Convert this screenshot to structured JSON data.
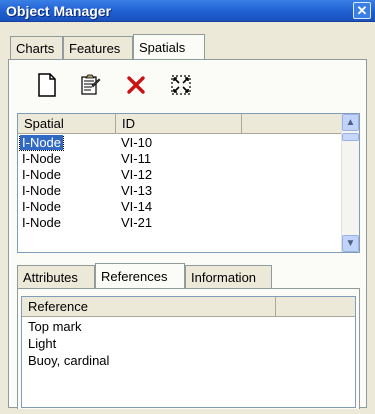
{
  "window": {
    "title": "Object Manager",
    "close_glyph": "✕"
  },
  "tabs": [
    "Charts",
    "Features",
    "Spatials"
  ],
  "active_tab": "Spatials",
  "toolbar": [
    "new-document-icon",
    "properties-icon",
    "delete-icon",
    "select-extent-icon"
  ],
  "spatial_list": {
    "columns": [
      "Spatial",
      "ID"
    ],
    "rows": [
      {
        "spatial": "I-Node",
        "id": "VI-10"
      },
      {
        "spatial": "I-Node",
        "id": "VI-11"
      },
      {
        "spatial": "I-Node",
        "id": "VI-12"
      },
      {
        "spatial": "I-Node",
        "id": "VI-13"
      },
      {
        "spatial": "I-Node",
        "id": "VI-14"
      },
      {
        "spatial": "I-Node",
        "id": "VI-21"
      }
    ],
    "selected_index": 0
  },
  "detail_tabs": [
    "Attributes",
    "References",
    "Information"
  ],
  "active_detail_tab": "References",
  "references": {
    "column": "Reference",
    "rows": [
      "Top mark",
      "Light",
      "Buoy, cardinal"
    ]
  },
  "colors": {
    "title_bar": "#1f5fd0",
    "selection": "#316ac5",
    "delete_red": "#cc1111"
  }
}
